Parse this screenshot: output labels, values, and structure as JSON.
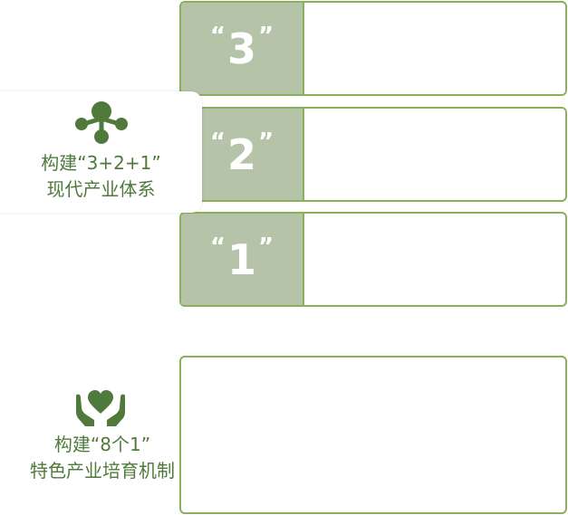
{
  "system": {
    "icon": "molecule-network-icon",
    "title_line1": "构建“3+2+1”",
    "title_line2": "现代产业体系",
    "items": [
      {
        "quote_open": "“",
        "number": "3",
        "quote_close": "”",
        "content": ""
      },
      {
        "quote_open": "“",
        "number": "2",
        "quote_close": "”",
        "content": ""
      },
      {
        "quote_open": "“",
        "number": "1",
        "quote_close": "”",
        "content": ""
      }
    ]
  },
  "mechanism": {
    "icon": "hands-holding-heart-icon",
    "title_line1": "构建“8个1”",
    "title_line2": "特色产业培育机制",
    "content": ""
  },
  "colors": {
    "accent": "#4f7a3b",
    "border": "#8ab05e",
    "badge_bg": "#b5c4a8"
  }
}
